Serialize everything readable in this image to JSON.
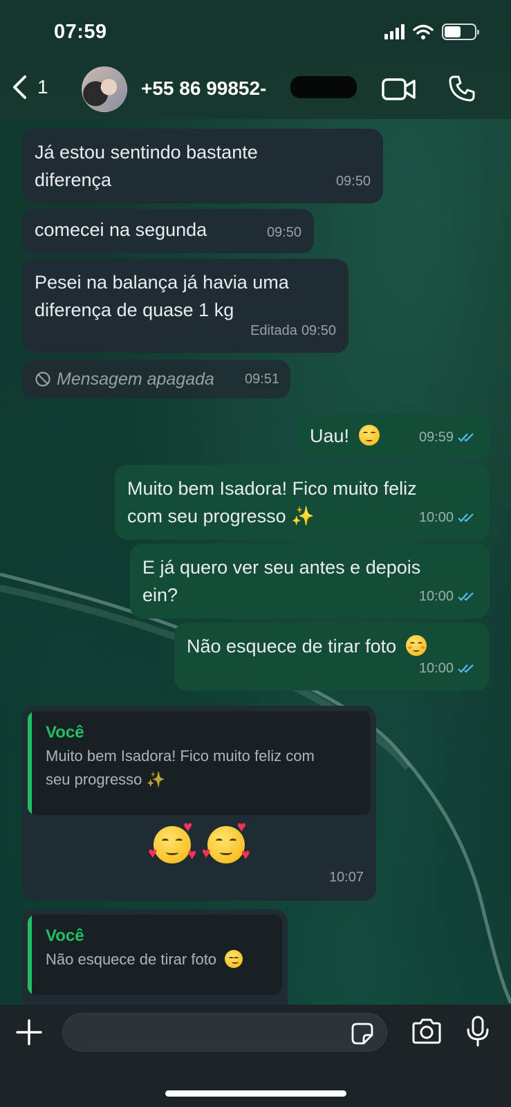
{
  "status_bar": {
    "time": "07:59"
  },
  "header": {
    "back_count": "1",
    "contact_name": "+55 86 99852-"
  },
  "messages": [
    {
      "direction": "in",
      "text_line1": "Já estou sentindo bastante",
      "text_line2": "diferença",
      "time": "09:50"
    },
    {
      "direction": "in",
      "text": "comecei na segunda",
      "time": "09:50"
    },
    {
      "direction": "in",
      "text_line1": "Pesei na balança já havia uma",
      "text_line2": "diferença de quase 1 kg",
      "edited": "Editada",
      "time": "09:50"
    },
    {
      "direction": "in",
      "text": "Mensagem apagada",
      "time": "09:51"
    },
    {
      "direction": "out",
      "text": "Uau!",
      "time": "09:59"
    },
    {
      "direction": "out",
      "text_line1": "Muito bem Isadora! Fico muito feliz",
      "text_line2": "com seu progresso ✨",
      "time": "10:00"
    },
    {
      "direction": "out",
      "text_line1": "E já quero ver seu antes e depois",
      "text_line2": "ein?",
      "time": "10:00"
    },
    {
      "direction": "out",
      "text": "Não esquece de tirar foto",
      "time": "10:00"
    },
    {
      "direction": "in",
      "quote_author": "Você",
      "quote_line1": "Muito bem Isadora! Fico muito feliz com",
      "quote_line2": "seu progresso ✨",
      "time": "10:07"
    },
    {
      "direction": "in",
      "quote_author": "Você",
      "quote_text": "Não esquece de tirar foto"
    }
  ],
  "composer": {
    "placeholder": ""
  }
}
